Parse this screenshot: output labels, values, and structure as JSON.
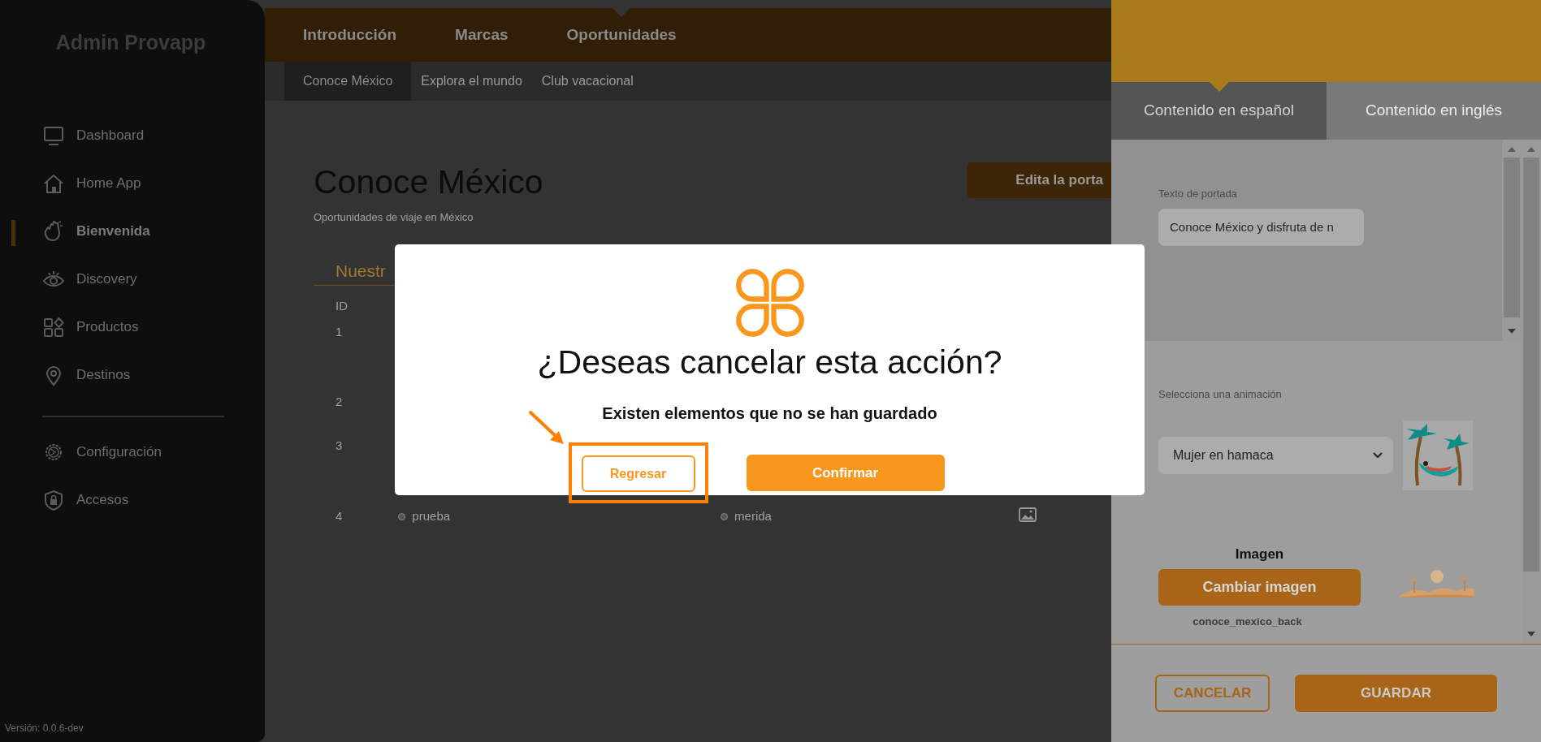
{
  "sidebar": {
    "title": "Admin Provapp",
    "groups": [
      {
        "items": [
          {
            "label": "Dashboard",
            "selected": false
          },
          {
            "label": "Home App",
            "selected": false
          },
          {
            "label": "Bienvenida",
            "selected": true
          },
          {
            "label": "Discovery",
            "selected": false
          },
          {
            "label": "Productos",
            "selected": false
          },
          {
            "label": "Destinos",
            "selected": false
          }
        ]
      },
      {
        "items": [
          {
            "label": "Configuración",
            "selected": false
          },
          {
            "label": "Accesos",
            "selected": false
          }
        ]
      }
    ],
    "version": "Versión: 0.0.6-dev"
  },
  "top_tabs": [
    {
      "label": "Introducción",
      "selected": false
    },
    {
      "label": "Marcas",
      "selected": false
    },
    {
      "label": "Oportunidades",
      "selected": true
    }
  ],
  "sub_tabs": [
    {
      "label": "Conoce México",
      "selected": true
    },
    {
      "label": "Explora el mundo",
      "selected": false
    },
    {
      "label": "Club vacacional",
      "selected": false
    }
  ],
  "page": {
    "title": "Conoce México",
    "subtitle": "Oportunidades de viaje en México",
    "edit_button": "Edita la porta"
  },
  "table": {
    "heading": "Nuestr",
    "columns": [
      "ID"
    ],
    "rows": [
      {
        "cells": [
          "1"
        ]
      },
      {
        "cells": [
          "2"
        ]
      },
      {
        "cells": [
          "3"
        ]
      },
      {
        "cells": [
          "4",
          "prueba",
          "merida"
        ],
        "image_icon": true
      }
    ]
  },
  "modal": {
    "title": "¿Deseas cancelar esta acción?",
    "message": "Existen elementos que no se han guardado",
    "buttons": [
      {
        "label": "Regresar",
        "kind": "outline",
        "highlighted": true
      },
      {
        "label": "Confirmar",
        "kind": "primary",
        "highlighted": false
      }
    ]
  },
  "panel": {
    "tabs": [
      {
        "label": "Contenido en español",
        "selected": true
      },
      {
        "label": "Contenido en inglés",
        "selected": false
      }
    ],
    "cover_text": {
      "label": "Texto de portada",
      "value": "Conoce México y disfruta de n"
    },
    "animation": {
      "label": "Selecciona una animación",
      "value": "Mujer en hamaca"
    },
    "image": {
      "label": "Imagen",
      "button": "Cambiar imagen",
      "filename": "conoce_mexico_back"
    },
    "buttons": [
      {
        "label": "CANCELAR",
        "kind": "outline"
      },
      {
        "label": "GUARDAR",
        "kind": "primary"
      }
    ]
  }
}
